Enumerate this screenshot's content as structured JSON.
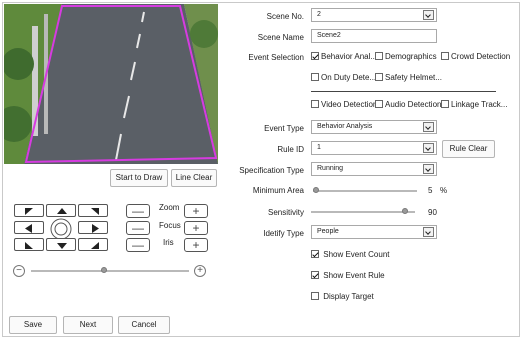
{
  "preview_actions": {
    "start_draw": "Start to Draw",
    "line_clear": "Line Clear"
  },
  "ptz": {
    "zoom_label": "Zoom",
    "focus_label": "Focus",
    "iris_label": "Iris",
    "minus": "—",
    "plus": "+"
  },
  "speed_slider": {
    "value_fraction": 0.46,
    "minus": "−",
    "plus": "+"
  },
  "form": {
    "scene_no": {
      "label": "Scene No.",
      "value": "2"
    },
    "scene_name": {
      "label": "Scene Name",
      "value": "Scene2"
    },
    "event_selection": {
      "label": "Event Selection",
      "options": [
        {
          "label": "Behavior Anal...",
          "checked": true
        },
        {
          "label": "Demographics",
          "checked": false
        },
        {
          "label": "Crowd Detection",
          "checked": false
        },
        {
          "label": "On Duty Dete...",
          "checked": false
        },
        {
          "label": "Safety Helmet...",
          "checked": false
        },
        {
          "label": "Video Detection",
          "checked": false
        },
        {
          "label": "Audio Detection",
          "checked": false
        },
        {
          "label": "Linkage Track...",
          "checked": false
        }
      ]
    },
    "event_type": {
      "label": "Event Type",
      "value": "Behavior Analysis"
    },
    "rule_id": {
      "label": "Rule ID",
      "value": "1",
      "rule_clear": "Rule Clear"
    },
    "specification_type": {
      "label": "Specification Type",
      "value": "Running"
    },
    "minimum_area": {
      "label": "Minimum Area",
      "value": "5",
      "unit": "%",
      "fraction": 0.03
    },
    "sensitivity": {
      "label": "Sensitivity",
      "value": "90",
      "fraction": 0.9
    },
    "identify_type": {
      "label": "Idetify Type",
      "value": "People"
    },
    "show_event_count": {
      "label": "Show Event Count",
      "checked": true
    },
    "show_event_rule": {
      "label": "Show Event Rule",
      "checked": true
    },
    "display_target": {
      "label": "Display Target",
      "checked": false
    }
  },
  "footer": {
    "save": "Save",
    "next": "Next",
    "cancel": "Cancel"
  },
  "colors": {
    "region_outline": "#d63be0",
    "road": "#5a5f66",
    "grass": "#5f8a3c"
  }
}
